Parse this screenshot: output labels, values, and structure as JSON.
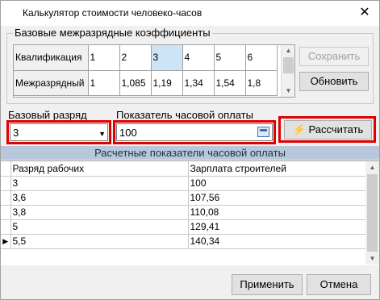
{
  "window": {
    "title": "Калькулятор стоимости человеко-часов",
    "close_glyph": "✕"
  },
  "coef_group": {
    "caption": "Базовые межразрядные коэффициенты",
    "row1": {
      "label": "Квалификация",
      "values": [
        "1",
        "2",
        "3",
        "4",
        "5",
        "6"
      ]
    },
    "row2": {
      "label": "Межразрядный",
      "values": [
        "1",
        "1,085",
        "1,19",
        "1,34",
        "1,54",
        "1,8"
      ]
    },
    "selected_column": 2,
    "save_label": "Сохранить",
    "refresh_label": "Обновить"
  },
  "base_rank": {
    "label": "Базовый разряд",
    "value": "3"
  },
  "hourly": {
    "label": "Показатель часовой оплаты",
    "value": "100"
  },
  "calculate_label": "Рассчитать",
  "results": {
    "header": "Расчетные показатели часовой оплаты",
    "columns": [
      "Разряд рабочих",
      "Зарплата строителей"
    ],
    "rows": [
      {
        "rank": "3",
        "salary": "100"
      },
      {
        "rank": "3,6",
        "salary": "107,56"
      },
      {
        "rank": "3,8",
        "salary": "110,08"
      },
      {
        "rank": "5",
        "salary": "129,41"
      },
      {
        "rank": "5,5",
        "salary": "140,34"
      }
    ],
    "current_row": 4
  },
  "footer": {
    "apply_label": "Применить",
    "cancel_label": "Отмена"
  },
  "colors": {
    "highlight": "#e00000",
    "results_header_bg": "#b9c7da",
    "selected_cell": "#cce4f7"
  }
}
